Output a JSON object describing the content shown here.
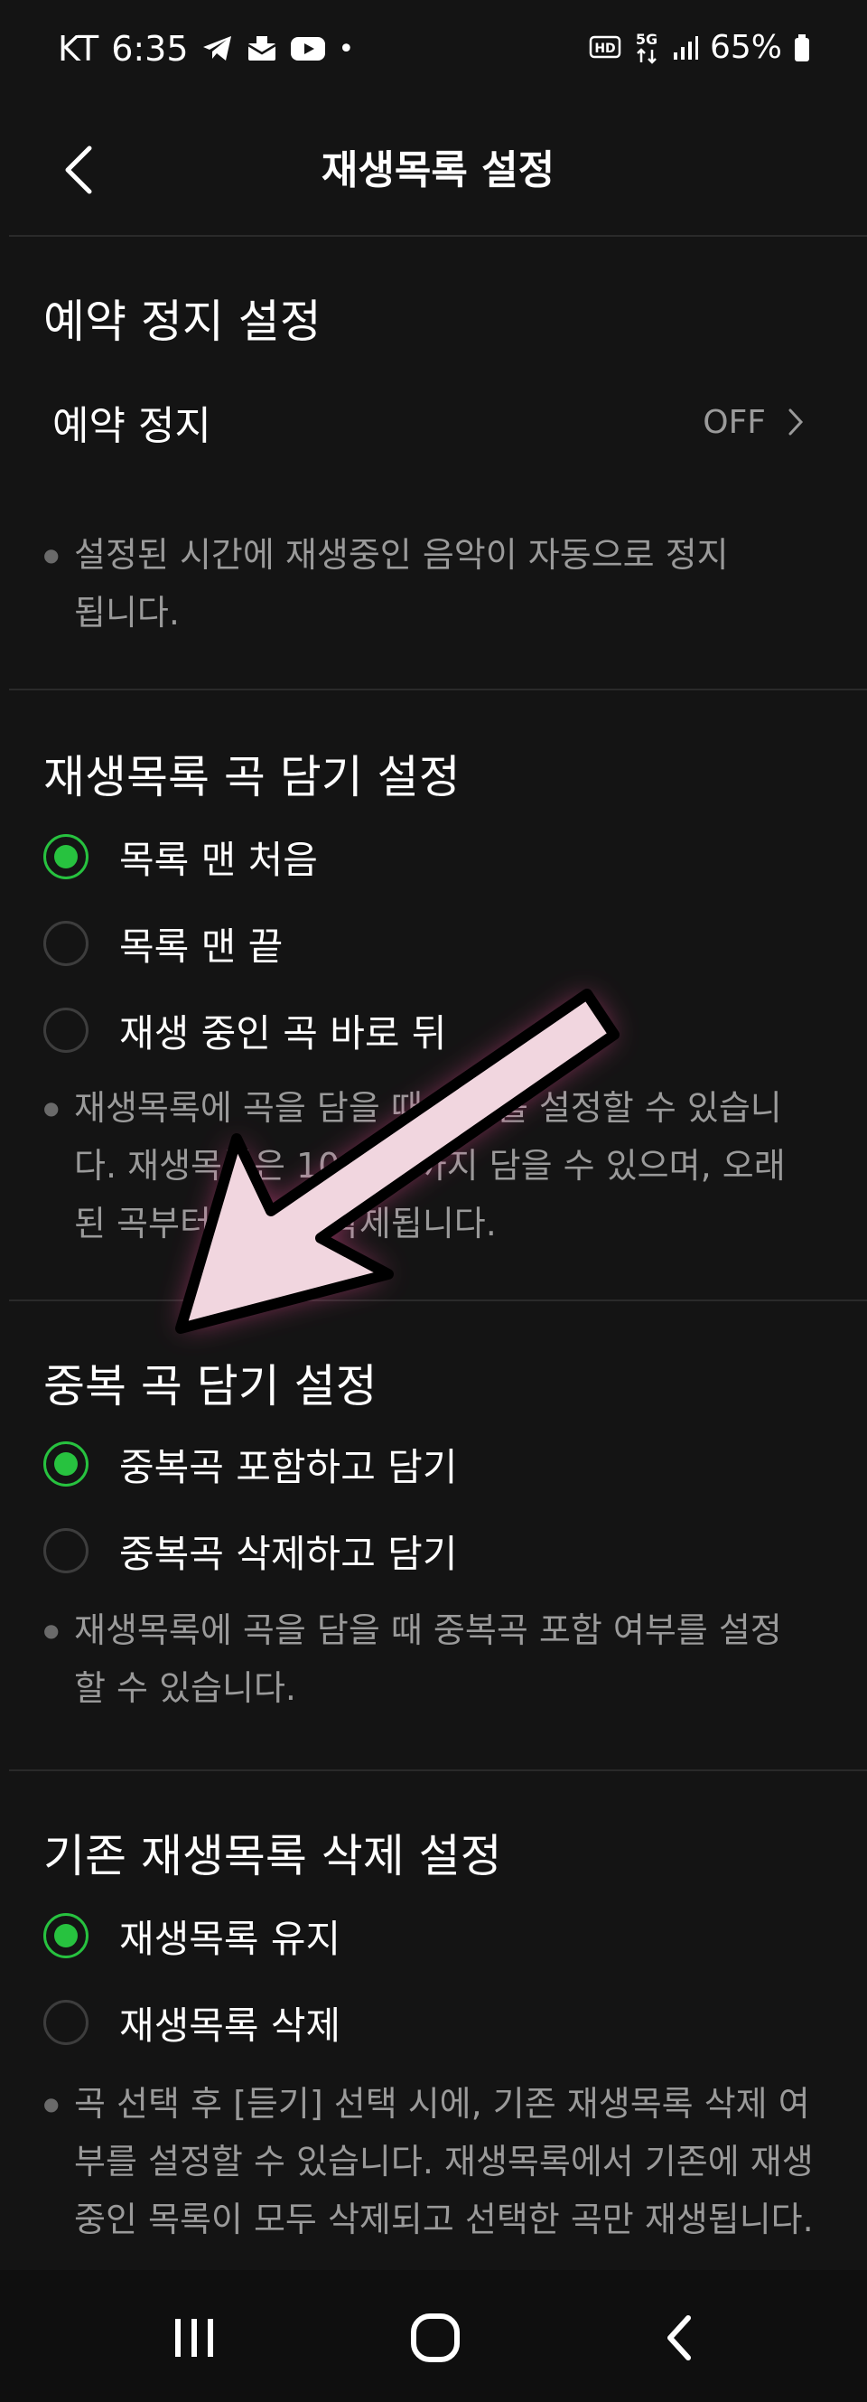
{
  "status_bar": {
    "carrier": "KT",
    "time": "6:35",
    "dot": "•",
    "battery": "65%",
    "network": "5G",
    "hd": "HD",
    "icons": [
      "telegram-icon",
      "mail-icon",
      "youtube-icon",
      "hd-voice-icon",
      "5g-icon",
      "signal-icon",
      "battery-icon"
    ]
  },
  "header": {
    "title": "재생목록 설정",
    "back_icon": "chevron-left-icon"
  },
  "sections": {
    "sleep": {
      "title": "예약 정지 설정",
      "row_label": "예약 정지",
      "row_value": "OFF",
      "note": "설정된 시간에 재생중인 음악이 자동으로 정지됩니다."
    },
    "add_position": {
      "title": "재생목록 곡 담기 설정",
      "options": [
        "목록 맨 처음",
        "목록 맨 끝",
        "재생 중인 곡 바로 뒤"
      ],
      "selected": 0,
      "note": "재생목록에 곡을 담을 때 위치를 설정할 수 있습니다. 재생목록은 1000곡까지 담을 수 있으며, 오래된 곡부터 차례로 삭제됩니다."
    },
    "duplicate": {
      "title": "중복 곡 담기 설정",
      "options": [
        "중복곡 포함하고 담기",
        "중복곡 삭제하고 담기"
      ],
      "selected": 0,
      "note": "재생목록에 곡을 담을 때 중복곡 포함 여부를 설정할 수 있습니다."
    },
    "delete_existing": {
      "title": "기존 재생목록 삭제 설정",
      "options": [
        "재생목록 유지",
        "재생목록 삭제"
      ],
      "selected": 0,
      "note": "곡 선택 후 [듣기] 선택 시에, 기존 재생목록 삭제 여부를 설정할 수 있습니다. 재생목록에서 기존에 재생 중인 목록이 모두 삭제되고 선택한 곡만 재생됩니다."
    }
  },
  "colors": {
    "background": "#141414",
    "accent_green": "#27c23f",
    "secondary_text": "#9a9a9a",
    "divider": "#2a2a2a",
    "arrow_fill": "#f1d6df",
    "arrow_glow": "#ff4fa0"
  },
  "nav_bar": {
    "icons": [
      "recent-apps-icon",
      "home-icon",
      "back-icon"
    ]
  }
}
